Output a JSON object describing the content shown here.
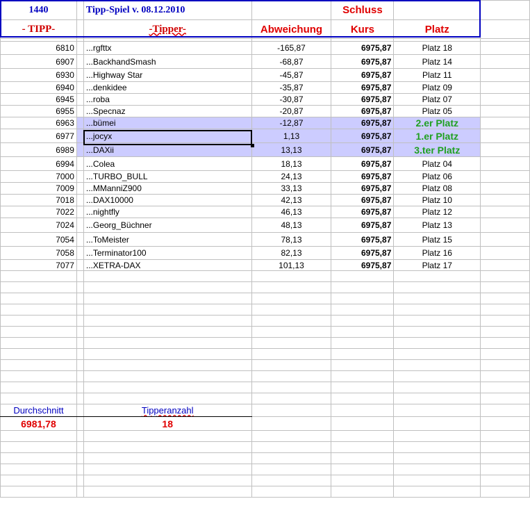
{
  "header": {
    "count": "1440",
    "title": "Tipp-Spiel v. 08.12.2010",
    "schluss": "Schluss",
    "tipp": "- TIPP-",
    "tipper": "-Tipper-",
    "abweichung": "Abweichung",
    "kurs": "Kurs",
    "platz": "Platz"
  },
  "rows": [
    {
      "tipp": "6810",
      "name": "...rgfttx",
      "abw": "-165,87",
      "kurs": "6975,87",
      "platz": "Platz 18"
    },
    {
      "tipp": "6907",
      "name": "...BackhandSmash",
      "abw": "-68,87",
      "kurs": "6975,87",
      "platz": "Platz 14"
    },
    {
      "tipp": "6930",
      "name": "...Highway Star",
      "abw": "-45,87",
      "kurs": "6975,87",
      "platz": "Platz 11"
    },
    {
      "tipp": "6940",
      "name": "...denkidee",
      "abw": "-35,87",
      "kurs": "6975,87",
      "platz": "Platz 09"
    },
    {
      "tipp": "6945",
      "name": "...roba",
      "abw": "-30,87",
      "kurs": "6975,87",
      "platz": "Platz 07"
    },
    {
      "tipp": "6955",
      "name": "...Specnaz",
      "abw": "-20,87",
      "kurs": "6975,87",
      "platz": "Platz 05"
    },
    {
      "tipp": "6963",
      "name": "...bümei",
      "abw": "-12,87",
      "kurs": "6975,87",
      "platz": "2.er Platz"
    },
    {
      "tipp": "6977",
      "name": "...jocyx",
      "abw": "1,13",
      "kurs": "6975,87",
      "platz": "1.er Platz"
    },
    {
      "tipp": "6989",
      "name": "...DAXii",
      "abw": "13,13",
      "kurs": "6975,87",
      "platz": "3.ter Platz"
    },
    {
      "tipp": "6994",
      "name": "...Colea",
      "abw": "18,13",
      "kurs": "6975,87",
      "platz": "Platz 04"
    },
    {
      "tipp": "7000",
      "name": "...TURBO_BULL",
      "abw": "24,13",
      "kurs": "6975,87",
      "platz": "Platz 06"
    },
    {
      "tipp": "7009",
      "name": "...MManniZ900",
      "abw": "33,13",
      "kurs": "6975,87",
      "platz": "Platz 08"
    },
    {
      "tipp": "7018",
      "name": "...DAX10000",
      "abw": "42,13",
      "kurs": "6975,87",
      "platz": "Platz 10"
    },
    {
      "tipp": "7022",
      "name": "...nightfly",
      "abw": "46,13",
      "kurs": "6975,87",
      "platz": "Platz 12"
    },
    {
      "tipp": "7024",
      "name": "...Georg_Büchner",
      "abw": "48,13",
      "kurs": "6975,87",
      "platz": "Platz 13"
    },
    {
      "tipp": "7054",
      "name": "...ToMeister",
      "abw": "78,13",
      "kurs": "6975,87",
      "platz": "Platz 15"
    },
    {
      "tipp": "7058",
      "name": "...Terminator100",
      "abw": "82,13",
      "kurs": "6975,87",
      "platz": "Platz 16"
    },
    {
      "tipp": "7077",
      "name": "...XETRA-DAX",
      "abw": "101,13",
      "kurs": "6975,87",
      "platz": "Platz 17"
    }
  ],
  "summary": {
    "avg_label": "Durchschnitt",
    "avg_value": "6981,78",
    "count_label": "Tipperanzahl",
    "count_value": "18"
  }
}
